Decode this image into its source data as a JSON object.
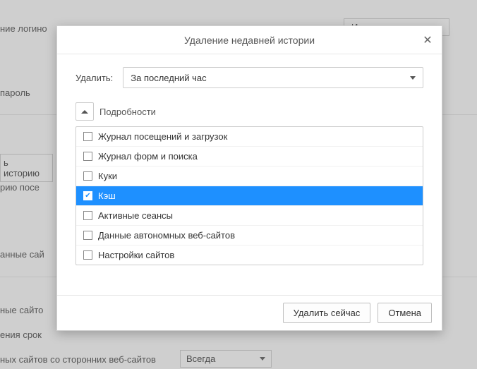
{
  "background": {
    "line1": "ние логино",
    "line2": "пароль",
    "btn1": "ь историю",
    "line3": "рию посе",
    "line4": "анные сай",
    "line5": "ные сайто",
    "line6": "ения срок",
    "line7": "ных сайтов со сторонних веб-сайтов",
    "select1": "И",
    "select2": "Всегда"
  },
  "dialog": {
    "title": "Удаление недавней истории",
    "range_label": "Удалить:",
    "range_value": "За последний час",
    "details_label": "Подробности",
    "items": [
      {
        "label": "Журнал посещений и загрузок",
        "checked": false,
        "selected": false
      },
      {
        "label": "Журнал форм и поиска",
        "checked": false,
        "selected": false
      },
      {
        "label": "Куки",
        "checked": false,
        "selected": false
      },
      {
        "label": "Кэш",
        "checked": true,
        "selected": true
      },
      {
        "label": "Активные сеансы",
        "checked": false,
        "selected": false
      },
      {
        "label": "Данные автономных веб-сайтов",
        "checked": false,
        "selected": false
      },
      {
        "label": "Настройки сайтов",
        "checked": false,
        "selected": false
      }
    ],
    "btn_clear": "Удалить сейчас",
    "btn_cancel": "Отмена"
  }
}
